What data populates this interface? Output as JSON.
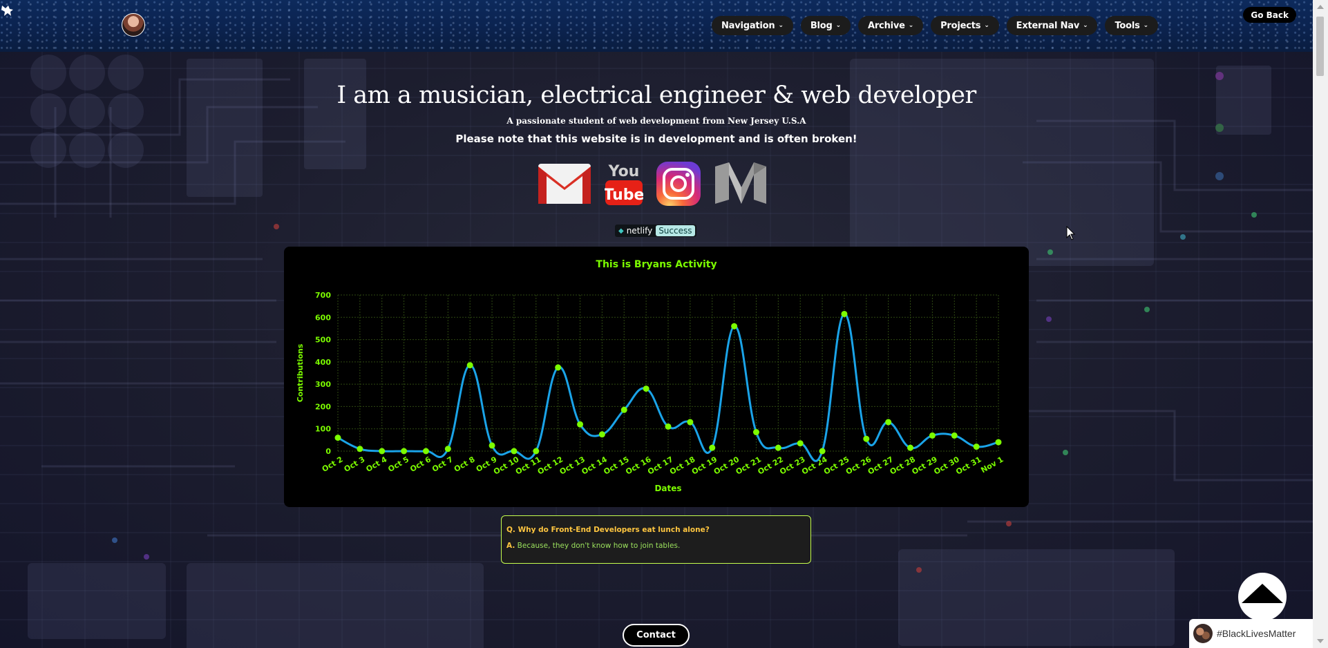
{
  "header": {
    "nav_items": [
      {
        "label": "Navigation"
      },
      {
        "label": "Blog"
      },
      {
        "label": "Archive"
      },
      {
        "label": "Projects"
      },
      {
        "label": "External Nav"
      },
      {
        "label": "Tools"
      }
    ],
    "go_back_label": "Go Back"
  },
  "hero": {
    "title": "I am a musician, electrical engineer & web developer",
    "subtitle": "A passionate student of web development from New Jersey U.S.A",
    "note": "Please note that this website is in development and is often broken!"
  },
  "socials": [
    {
      "icon": "gmail-icon"
    },
    {
      "icon": "youtube-icon"
    },
    {
      "icon": "instagram-icon"
    },
    {
      "icon": "medium-icon"
    }
  ],
  "netlify": {
    "name": "netlify",
    "status": "Success"
  },
  "chart_data": {
    "type": "line",
    "title": "This is Bryans Activity",
    "xlabel": "Dates",
    "ylabel": "Contributions",
    "ylim": [
      0,
      700
    ],
    "yticks": [
      0,
      100,
      200,
      300,
      400,
      500,
      600,
      700
    ],
    "grid": true,
    "line_color": "#1aa3e8",
    "point_color": "#7cfc00",
    "label_color": "#7cfc00",
    "categories": [
      "Oct 2",
      "Oct 3",
      "Oct 4",
      "Oct 5",
      "Oct 6",
      "Oct 7",
      "Oct 8",
      "Oct 9",
      "Oct 10",
      "Oct 11",
      "Oct 12",
      "Oct 13",
      "Oct 14",
      "Oct 15",
      "Oct 16",
      "Oct 17",
      "Oct 18",
      "Oct 19",
      "Oct 20",
      "Oct 21",
      "Oct 22",
      "Oct 23",
      "Oct 24",
      "Oct 25",
      "Oct 26",
      "Oct 27",
      "Oct 28",
      "Oct 29",
      "Oct 30",
      "Oct 31",
      "Nov 1"
    ],
    "values": [
      60,
      10,
      0,
      0,
      0,
      10,
      385,
      25,
      0,
      0,
      375,
      120,
      75,
      185,
      280,
      110,
      130,
      15,
      560,
      85,
      15,
      35,
      0,
      615,
      55,
      130,
      15,
      70,
      70,
      20,
      40
    ]
  },
  "joke": {
    "q_prefix": "Q.",
    "question": "Why do Front-End Developers eat lunch alone?",
    "a_prefix": "A.",
    "answer": "Because, they don't know how to join tables."
  },
  "contact_label": "Contact",
  "blm_label": "#BlackLivesMatter"
}
